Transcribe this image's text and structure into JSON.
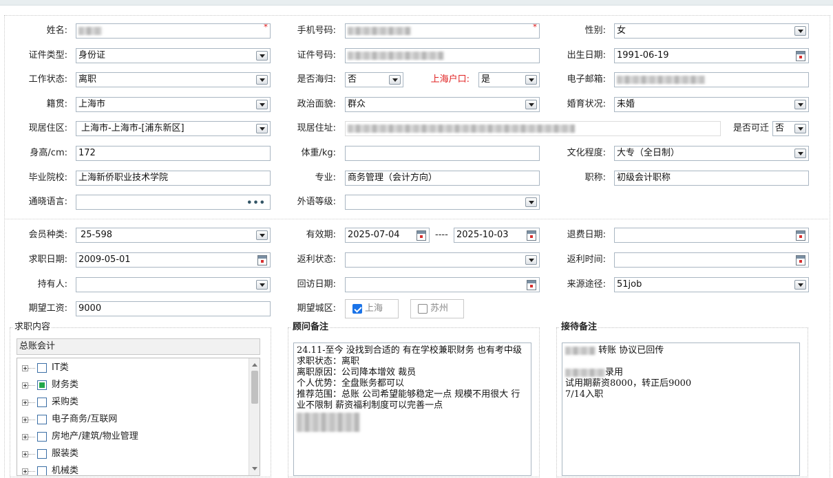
{
  "personal": {
    "name_label": "姓名:",
    "phone_label": "手机号码:",
    "gender_label": "性别:",
    "gender_value": "女",
    "id_type_label": "证件类型:",
    "id_type_value": "身份证",
    "id_no_label": "证件号码:",
    "birth_label": "出生日期:",
    "birth_value": "1991-06-19",
    "work_status_label": "工作状态:",
    "work_status_value": "离职",
    "returnee_label": "是否海归:",
    "returnee_value": "否",
    "sh_hukou_label": "上海户口:",
    "sh_hukou_value": "是",
    "email_label": "电子邮箱:",
    "native_label": "籍贯:",
    "native_value": "上海市",
    "political_label": "政治面貌:",
    "political_value": "群众",
    "marital_label": "婚育状况:",
    "marital_value": "未婚",
    "residence_area_label": "现居住区:",
    "residence_area_value": "上海市-上海市-[浦东新区]",
    "residence_addr_label": "现居住址:",
    "relocate_label": "是否可迁",
    "relocate_value": "否",
    "height_label": "身高/cm:",
    "height_value": "172",
    "weight_label": "体重/kg:",
    "weight_value": "",
    "education_label": "文化程度:",
    "education_value": "大专（全日制）",
    "school_label": "毕业院校:",
    "school_value": "上海新侨职业技术学院",
    "major_label": "专业:",
    "major_value": "商务管理（会计方向）",
    "title_label": "职称:",
    "title_value": "初级会计职称",
    "language_label": "通晓语言:",
    "foreign_level_label": "外语等级:"
  },
  "membership": {
    "member_type_label": "会员种类:",
    "member_type_value": "25-598",
    "valid_label": "有效期:",
    "valid_start": "2025-07-04",
    "valid_sep": "----",
    "valid_end": "2025-10-03",
    "refund_date_label": "退费日期:",
    "job_date_label": "求职日期:",
    "job_date_value": "2009-05-01",
    "rebate_status_label": "返利状态:",
    "rebate_time_label": "返利时间:",
    "holder_label": "持有人:",
    "revisit_label": "回访日期:",
    "source_label": "来源途径:",
    "source_value": "51job",
    "salary_label": "期望工资:",
    "salary_value": "9000",
    "city_label": "期望城区:",
    "city_options": [
      {
        "label": "上海",
        "checked": true
      },
      {
        "label": "苏州",
        "checked": false
      }
    ]
  },
  "job_content": {
    "title": "求职内容",
    "search_value": "总账会计",
    "categories": [
      {
        "label": "IT类",
        "partial": false
      },
      {
        "label": "财务类",
        "partial": true
      },
      {
        "label": "采购类",
        "partial": false
      },
      {
        "label": "电子商务/互联网",
        "partial": false
      },
      {
        "label": "房地产/建筑/物业管理",
        "partial": false
      },
      {
        "label": "服装类",
        "partial": false
      },
      {
        "label": "机械类",
        "partial": false
      }
    ]
  },
  "advisor_notes": {
    "title": "顾问备注",
    "text": "24.11-至今 没找到合适的 有在学校兼职财务 也有考中级\n求职状态：离职\n离职原因：公司降本增效 裁员\n个人优势：全盘账务都可以\n推荐范围：总账 公司希望能够稳定一点 规模不用很大 行业不限制 薪资福利制度可以完善一点"
  },
  "reception_notes": {
    "title": "接待备注",
    "line1": "转账 协议已回传",
    "line2": "录用",
    "text": "试用期薪资8000，转正后9000\n7/14入职"
  }
}
